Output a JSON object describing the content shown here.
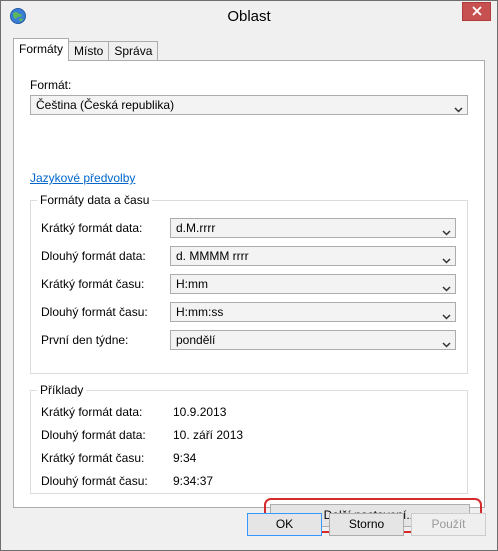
{
  "window": {
    "title": "Oblast"
  },
  "tabs": [
    {
      "label": "Formáty",
      "active": true
    },
    {
      "label": "Místo",
      "active": false
    },
    {
      "label": "Správa",
      "active": false
    }
  ],
  "format": {
    "label": "Formát:",
    "value": "Čeština (Česká republika)"
  },
  "language_link": "Jazykové předvolby",
  "date_time_group": {
    "title": "Formáty data a času",
    "rows": [
      {
        "label": "Krátký formát data:",
        "value": "d.M.rrrr"
      },
      {
        "label": "Dlouhý formát data:",
        "value": "d. MMMM rrrr"
      },
      {
        "label": "Krátký formát času:",
        "value": "H:mm"
      },
      {
        "label": "Dlouhý formát času:",
        "value": "H:mm:ss"
      },
      {
        "label": "První den týdne:",
        "value": "pondělí"
      }
    ]
  },
  "examples_group": {
    "title": "Příklady",
    "rows": [
      {
        "label": "Krátký formát data:",
        "value": "10.9.2013"
      },
      {
        "label": "Dlouhý formát data:",
        "value": "10. září 2013"
      },
      {
        "label": "Krátký formát času:",
        "value": "9:34"
      },
      {
        "label": "Dlouhý formát času:",
        "value": "9:34:37"
      }
    ]
  },
  "more_settings_button": "Další nastavení...",
  "footer": {
    "ok": "OK",
    "cancel": "Storno",
    "apply": "Použít"
  },
  "colors": {
    "link": "#0066cc",
    "highlight": "#d62a2a",
    "close": "#c75050"
  }
}
